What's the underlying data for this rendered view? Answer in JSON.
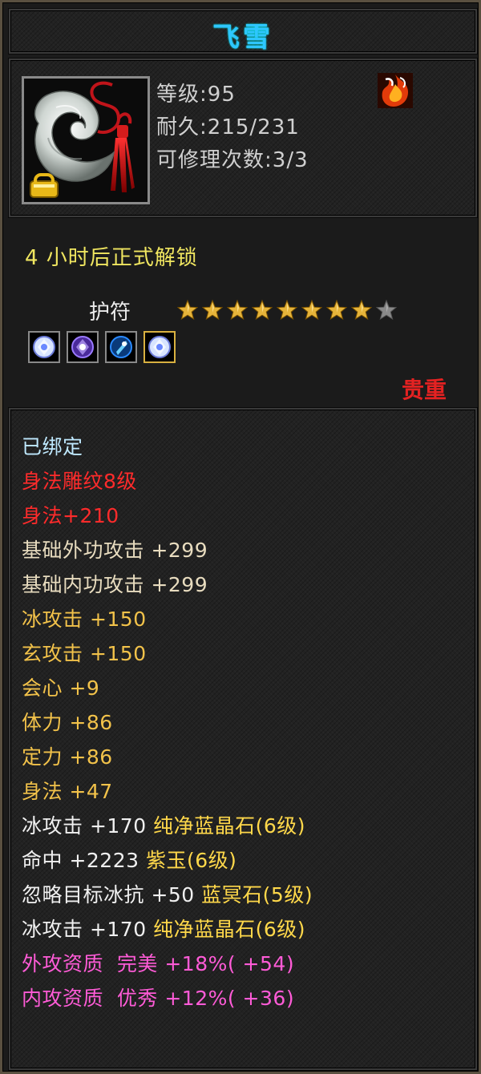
{
  "tooltip": {
    "item_name": "飞雪",
    "icon": "jade-pendant-icon",
    "stats": [
      {
        "label": "等级",
        "value": ":95"
      },
      {
        "label": "耐久",
        "value": ":215/231"
      },
      {
        "label": "可修理次数",
        "value": ":3/3"
      }
    ],
    "corner_icon": "flame-emblem-icon",
    "unlock_text": "4 小时后正式解锁",
    "slot_type": "护符",
    "stars": {
      "filled": 8,
      "total": 9
    },
    "gems": [
      "crystal-gem-icon",
      "purple-gem-icon",
      "blue-gem-icon",
      "crystal-gem-icon"
    ],
    "rarity": "贵重",
    "properties": [
      {
        "text": "已绑定",
        "color": "#bfe9ff"
      },
      {
        "text": "身法雕纹8级",
        "color": "#ff2b2b"
      },
      {
        "text": "身法+210",
        "color": "#ff2b2b"
      },
      {
        "text": "基础外功攻击 +299",
        "color": "#e8dcbf"
      },
      {
        "text": "基础内功攻击 +299",
        "color": "#e8dcbf"
      },
      {
        "text": "冰攻击 +150",
        "color": "#f2c24a"
      },
      {
        "text": "玄攻击 +150",
        "color": "#f2c24a"
      },
      {
        "text": "会心 +9",
        "color": "#f2c24a"
      },
      {
        "text": "体力 +86",
        "color": "#f2c24a"
      },
      {
        "text": "定力 +86",
        "color": "#f2c24a"
      },
      {
        "text": "身法 +47",
        "color": "#f2c24a"
      }
    ],
    "gem_properties": [
      {
        "stat": "冰攻击 +170",
        "gem": "纯净蓝晶石(6级)"
      },
      {
        "stat": "命中 +2223",
        "gem": "紫玉(6级)"
      },
      {
        "stat": "忽略目标冰抗 +50",
        "gem": "蓝冥石(5级)"
      },
      {
        "stat": "冰攻击 +170",
        "gem": "纯净蓝晶石(6级)"
      }
    ],
    "aptitudes": [
      {
        "text": "外攻资质  完美 +18%( +54)",
        "color": "#ff5bd7"
      },
      {
        "text": "内攻资质  优秀 +12%( +36)",
        "color": "#ff5bd7"
      }
    ]
  },
  "colors": {
    "title": "#2ec6ff",
    "star_filled": "#e6b43a",
    "star_empty": "#8a8a8a",
    "rarity": "#e42222",
    "gem_stat": "#f0f0f0",
    "gem_name": "#ffd84a"
  }
}
